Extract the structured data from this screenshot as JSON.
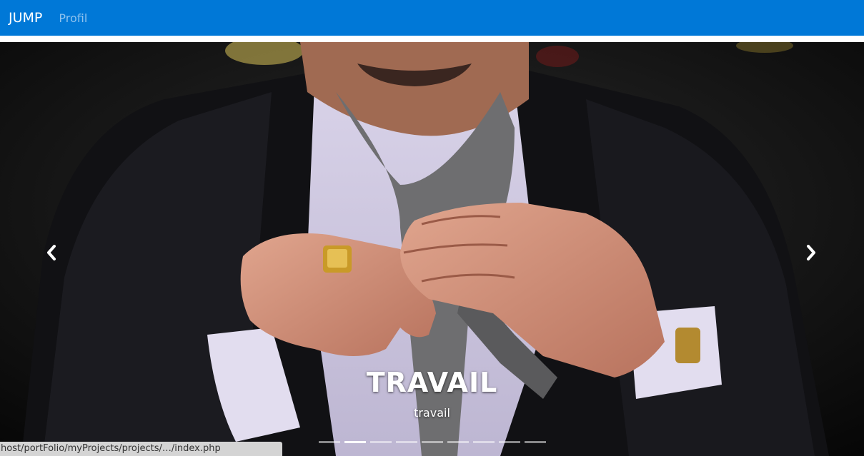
{
  "navbar": {
    "brand": "JUMP",
    "links": [
      "Profil"
    ],
    "background": "#0078d7"
  },
  "carousel": {
    "slide": {
      "title": "TRAVAIL",
      "subtitle": "travail"
    },
    "indicators": {
      "count": 9,
      "active_index": 1
    },
    "prev_icon": "chevron-left-icon",
    "next_icon": "chevron-right-icon"
  },
  "status_bar": {
    "url": "host/portFolio/myProjects/projects/…/index.php"
  }
}
